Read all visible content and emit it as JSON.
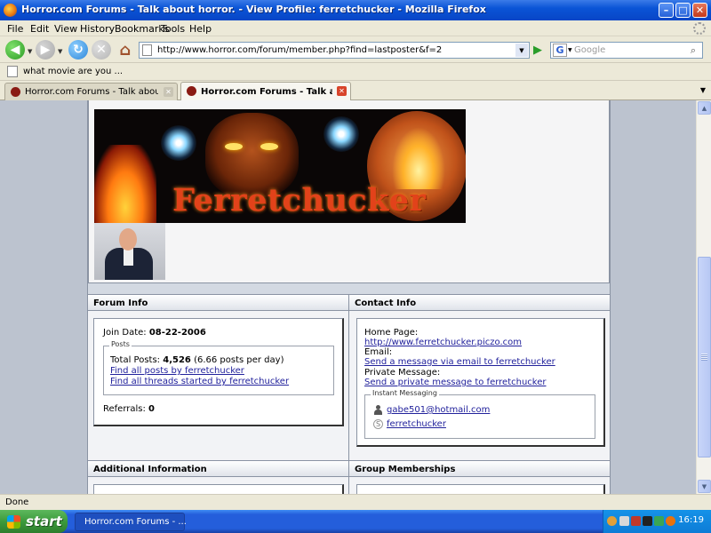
{
  "window": {
    "title": "Horror.com Forums - Talk about horror. - View Profile: ferretchucker - Mozilla Firefox"
  },
  "menu": [
    "File",
    "Edit",
    "View",
    "History",
    "Bookmarks",
    "Tools",
    "Help"
  ],
  "nav": {
    "url": "http://www.horror.com/forum/member.php?find=lastposter&f=2",
    "search_placeholder": "Google"
  },
  "bookmarks": [
    {
      "label": "what movie are you ..."
    }
  ],
  "tabs": [
    {
      "label": "Horror.com Forums - Talk about horro...",
      "active": false
    },
    {
      "label": "Horror.com Forums - Talk about ...",
      "active": true
    }
  ],
  "profile": {
    "banner_text": "Ferretchucker",
    "forum_info": {
      "heading": "Forum Info",
      "join_label": "Join Date:",
      "join_value": "08-22-2006",
      "posts_legend": "Posts",
      "total_posts_label": "Total Posts:",
      "total_posts_value": "4,526",
      "posts_per_day": "(6.66 posts per day)",
      "find_posts_link": "Find all posts by ferretchucker",
      "find_threads_link": "Find all threads started by ferretchucker",
      "referrals_label": "Referrals:",
      "referrals_value": "0"
    },
    "contact_info": {
      "heading": "Contact Info",
      "homepage_label": "Home Page:",
      "homepage_link": "http://www.ferretchucker.piczo.com",
      "email_label": "Email:",
      "email_link": "Send a message via email to ferretchucker",
      "pm_label": "Private Message:",
      "pm_link": "Send a private message to ferretchucker",
      "im_legend": "Instant Messaging",
      "msn": "gabe501@hotmail.com",
      "skype": "ferretchucker"
    },
    "additional_heading": "Additional Information",
    "groups_heading": "Group Memberships"
  },
  "status": {
    "text": "Done"
  },
  "taskbar": {
    "start_label": "start",
    "task_label": "Horror.com Forums - ...",
    "clock": "16:19"
  },
  "colors": {
    "title_bar": "#0a54d6",
    "link": "#22229c",
    "banner_text": "#e2421a",
    "taskbar": "#245edb"
  }
}
